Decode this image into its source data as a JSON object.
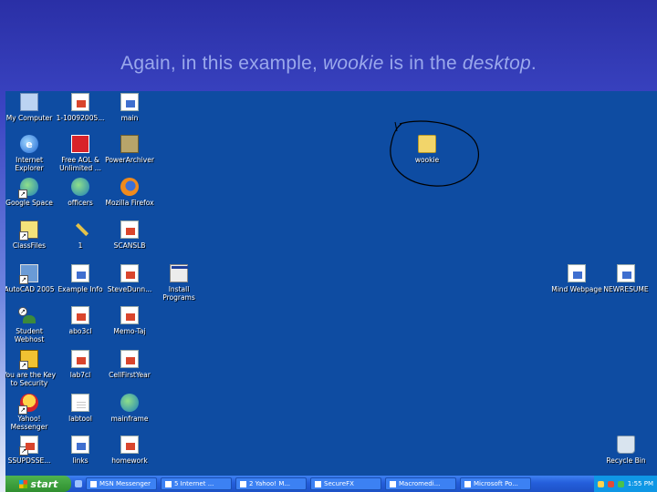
{
  "slide": {
    "title_part1": "Again, in this example, ",
    "title_italic1": "wookie",
    "title_part2": " is in the ",
    "title_italic2": "desktop",
    "title_part3": "."
  },
  "desktop": {
    "icons": {
      "my_computer": {
        "label": "My Computer",
        "icon": "computer-icon"
      },
      "file_2005": {
        "label": "1-10092005...",
        "icon": "document-icon"
      },
      "main": {
        "label": "main",
        "icon": "word-document-icon"
      },
      "internet_explorer": {
        "label": "Internet Explorer",
        "icon": "internet-explorer-icon"
      },
      "free_aol": {
        "label": "Free AOL & Unlimited ...",
        "icon": "aol-icon"
      },
      "power_archiver": {
        "label": "PowerArchiver",
        "icon": "archive-icon"
      },
      "wookie": {
        "label": "wookie",
        "icon": "folder-icon"
      },
      "google_space": {
        "label": "Google Space",
        "icon": "globe-icon"
      },
      "officers": {
        "label": "officers",
        "icon": "globe-icon"
      },
      "mozilla_firefox": {
        "label": "Mozilla Firefox",
        "icon": "firefox-icon"
      },
      "class_files": {
        "label": "ClassFiles",
        "icon": "calendar-icon"
      },
      "one": {
        "label": "1",
        "icon": "pen-icon"
      },
      "scanslb": {
        "label": "SCANSLB",
        "icon": "document-icon"
      },
      "autocad": {
        "label": "AutoCAD 2005",
        "icon": "autocad-icon"
      },
      "example_info": {
        "label": "Example Info",
        "icon": "word-document-icon"
      },
      "steve_dunn": {
        "label": "SteveDunn...",
        "icon": "document-icon"
      },
      "install_programs": {
        "label": "Install Programs",
        "icon": "installer-icon"
      },
      "student_webhost": {
        "label": "Student Webhost",
        "icon": "person-icon"
      },
      "abo3cl": {
        "label": "abo3cl",
        "icon": "document-icon"
      },
      "memo_taj": {
        "label": "Memo-Taj",
        "icon": "document-icon"
      },
      "youre_the_key": {
        "label": "You are the Key to Security",
        "icon": "warning-icon"
      },
      "lab7cl": {
        "label": "lab7cl",
        "icon": "document-icon"
      },
      "cellfirstyear": {
        "label": "CellFirstYear",
        "icon": "document-icon"
      },
      "yahoo_messenger": {
        "label": "Yahoo! Messenger",
        "icon": "messenger-icon"
      },
      "labtool": {
        "label": "labtool",
        "icon": "text-document-icon"
      },
      "mainframe": {
        "label": "mainframe",
        "icon": "web-document-icon"
      },
      "bottom_left": {
        "label": "SSUPDSSE...",
        "icon": "document-icon"
      },
      "links": {
        "label": "links",
        "icon": "word-document-icon"
      },
      "homework": {
        "label": "homework",
        "icon": "document-icon"
      },
      "mind_webpage": {
        "label": "Mind Webpage",
        "icon": "word-document-icon"
      },
      "newresume": {
        "label": "NEWRESUME",
        "icon": "word-document-icon"
      },
      "recycle_bin": {
        "label": "Recycle Bin",
        "icon": "recycle-bin-icon"
      }
    }
  },
  "taskbar": {
    "start_label": "start",
    "tasks": [
      {
        "label": "MSN Messenger"
      },
      {
        "label": "5 Internet ..."
      },
      {
        "label": "2 Yahoo! M..."
      },
      {
        "label": "SecureFX"
      },
      {
        "label": "Macromedi..."
      },
      {
        "label": "Microsoft Po..."
      }
    ],
    "clock": "1:55 PM"
  },
  "colors": {
    "desktop_bg": "#0e4ca2",
    "taskbar": "#245edb",
    "start_button": "#2f8f2f",
    "annotation_circle": "#000000"
  }
}
